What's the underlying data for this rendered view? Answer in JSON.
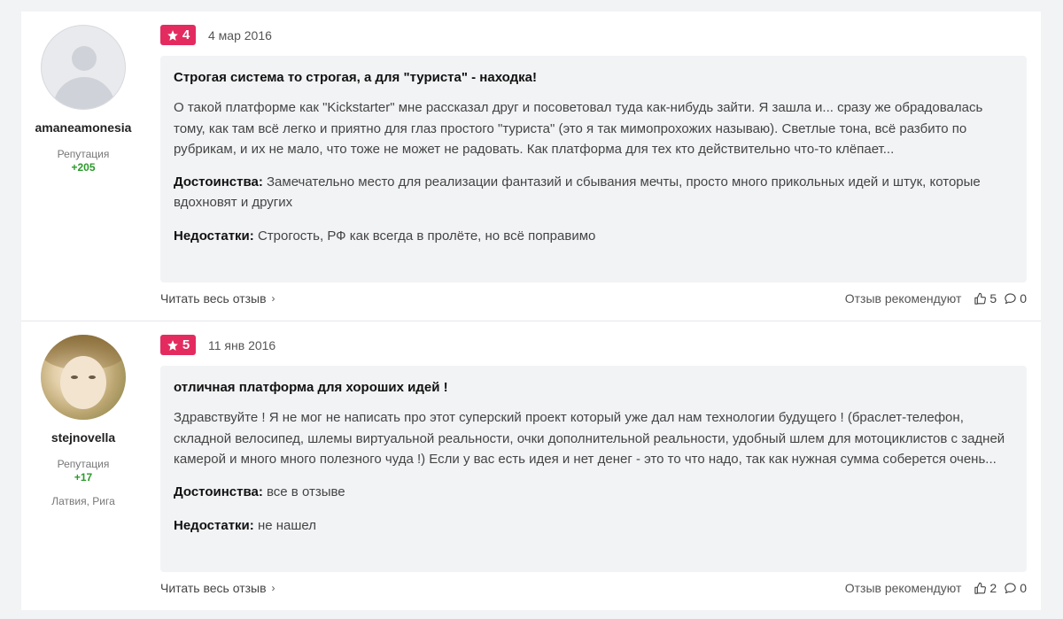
{
  "reviews": [
    {
      "author": {
        "username": "amaneamonesia",
        "reputation_label": "Репутация",
        "reputation_value": "+205",
        "location": ""
      },
      "rating": "4",
      "date": "4 мар 2016",
      "title": "Строгая система то строгая, а для \"туриста\" - находка!",
      "text": "О такой платформе как \"Kickstarter\" мне рассказал друг и посоветовал туда как-нибудь зайти. Я зашла и... сразу же обрадовалась тому, как там всё легко и приятно для глаз простого \"туриста\" (это я так мимопрохожих называю). Светлые тона, всё разбито по рубрикам, и их не мало, что тоже не может не радовать. Как платформа для тех кто действительно что-то клёпает...",
      "pros_label": "Достоинства:",
      "pros": "Замечательно место для реализации фантазий и сбывания мечты, просто много прикольных идей и штук, которые вдохновят и других",
      "cons_label": "Недостатки:",
      "cons": "Строгость, РФ как всегда в пролёте, но всё поправимо",
      "read_more": "Читать весь отзыв",
      "recommend_label": "Отзыв рекомендуют",
      "likes": "5",
      "comments": "0"
    },
    {
      "author": {
        "username": "stejnovella",
        "reputation_label": "Репутация",
        "reputation_value": "+17",
        "location": "Латвия, Рига"
      },
      "rating": "5",
      "date": "11 янв 2016",
      "title": "отличная платформа для хороших идей !",
      "text": "Здравствуйте ! Я не мог не написать про этот суперский проект который уже дал нам технологии будущего ! (браслет-телефон, складной велосипед, шлемы виртуальной реальности, очки дополнительной реальности, удобный шлем для мотоциклистов с задней камерой и много много полезного чуда !) Если у вас есть идея и нет денег - это то что надо, так как нужная сумма соберется очень...",
      "pros_label": "Достоинства:",
      "pros": "все в отзыве",
      "cons_label": "Недостатки:",
      "cons": "не нашел",
      "read_more": "Читать весь отзыв",
      "recommend_label": "Отзыв рекомендуют",
      "likes": "2",
      "comments": "0"
    }
  ],
  "icons": {
    "star": "star-icon",
    "chevron": "chevron-right-icon",
    "like": "thumbs-up-icon",
    "comment": "comment-icon"
  },
  "colors": {
    "rating_badge": "#e42b5f",
    "reputation": "#2b9a2b"
  }
}
